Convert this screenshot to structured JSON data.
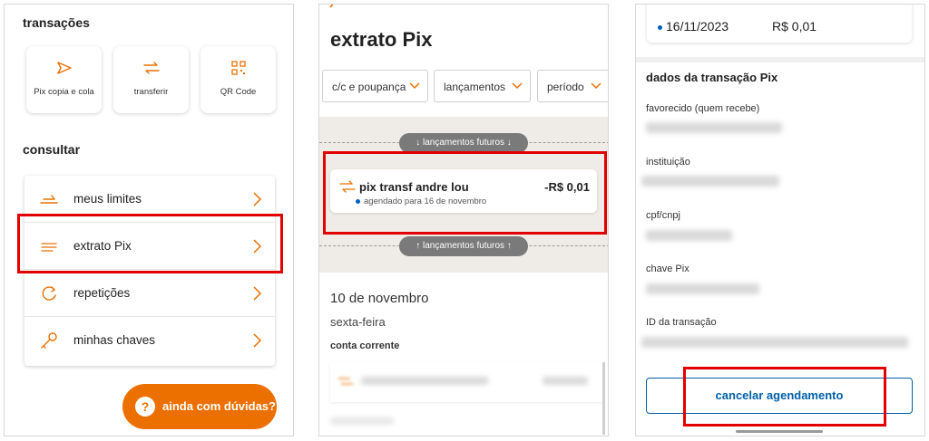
{
  "panel1": {
    "section_transactions": "transações",
    "quick_actions": [
      {
        "label": "Pix copia e cola",
        "icon": "send-icon"
      },
      {
        "label": "transferir",
        "icon": "transfer-icon"
      },
      {
        "label": "QR Code",
        "icon": "qr-code-icon"
      }
    ],
    "section_consult": "consultar",
    "menu_items": [
      {
        "label": "meus limites",
        "icon": "limits-icon"
      },
      {
        "label": "extrato Pix",
        "icon": "statement-icon"
      },
      {
        "label": "repetições",
        "icon": "repeat-icon"
      },
      {
        "label": "minhas chaves",
        "icon": "key-icon"
      }
    ],
    "help_button": {
      "icon_text": "?",
      "label": "ainda com dúvidas?"
    }
  },
  "panel2": {
    "title": "extrato Pix",
    "filters": [
      "c/c e poupança",
      "lançamentos",
      "período"
    ],
    "future_top_label": "lançamentos futuros",
    "future_bottom_label": "lançamentos futuros",
    "transaction": {
      "name": "pix transf andre lou",
      "value": "-R$ 0,01",
      "detail": "agendado para 16 de novembro"
    },
    "date": "10 de novembro",
    "weekday": "sexta-feira",
    "account": "conta corrente"
  },
  "panel3": {
    "scheduled_date": "16/11/2023",
    "scheduled_value": "R$ 0,01",
    "section_title": "dados da transação Pix",
    "fields": [
      "favorecido (quem recebe)",
      "instituição",
      "cpf/cnpj",
      "chave Pix",
      "ID da transação"
    ],
    "cancel_button": "cancelar agendamento"
  },
  "colors": {
    "accent_orange": "#ec7000",
    "highlight_red": "#e20000",
    "link_blue": "#0060a8",
    "dot_blue": "#0060c0"
  }
}
